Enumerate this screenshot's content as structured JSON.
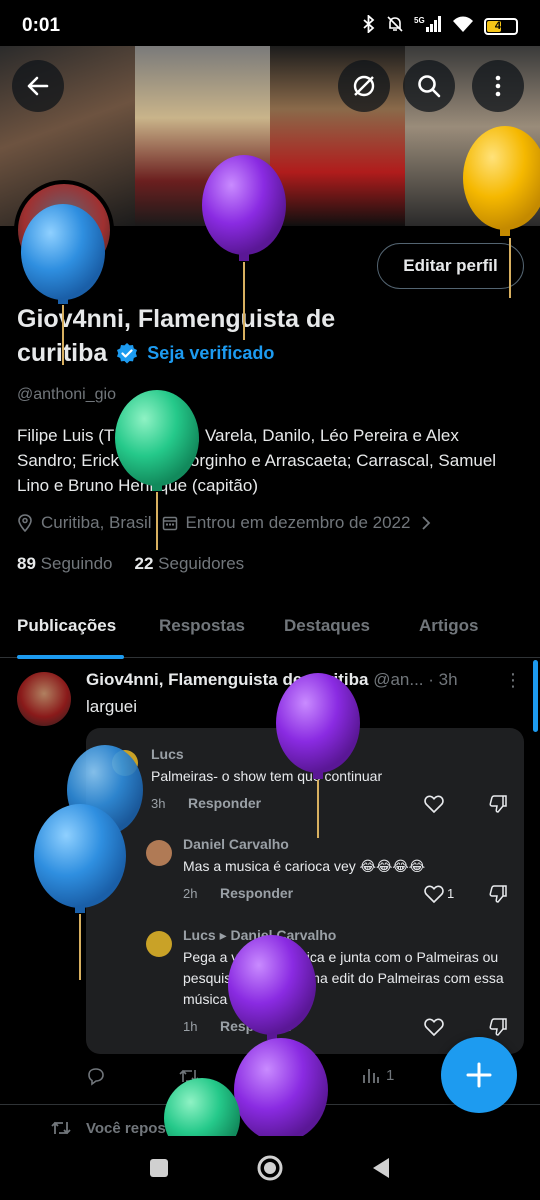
{
  "status_bar": {
    "time": "0:01",
    "network": "5G",
    "battery_level": "45",
    "battery_fraction": 0.45,
    "icons": [
      "bluetooth-icon",
      "mute-icon",
      "signal-icon",
      "wifi-icon",
      "battery-icon"
    ]
  },
  "header": {
    "back_icon": "arrow-left-icon",
    "no_image_icon": "image-off-icon",
    "search_icon": "search-icon",
    "more_icon": "more-vertical-icon"
  },
  "profile": {
    "edit_button": "Editar perfil",
    "name_line1": "Giov4nni, Flamenguista de",
    "name_line2": "curitiba",
    "verify_link": "Seja verificado",
    "handle": "@anthoni_gio",
    "bio": "Filipe Luis (TEC), Rossi, Varela, Danilo, Léo Pereira e Alex Sandro; Erick Pulgar, Jorginho e Arrascaeta; Carrascal, Samuel Lino e Bruno Henrique (capitão)",
    "location": "Curitiba, Brasil",
    "joined": "Entrou em dezembro de 2022",
    "following_count": "89",
    "following_label": "Seguindo",
    "followers_count": "22",
    "followers_label": "Seguidores"
  },
  "tabs": [
    {
      "label": "Publicações",
      "active": true
    },
    {
      "label": "Respostas",
      "active": false
    },
    {
      "label": "Destaques",
      "active": false
    },
    {
      "label": "Artigos",
      "active": false
    }
  ],
  "post": {
    "author": "Giov4nni, Flamenguista de curitiba",
    "handle_time": "@an... · 3h",
    "text": "larguei",
    "comments": [
      {
        "name": "Lucs",
        "text": "Palmeiras- o show tem que continuar",
        "time": "3h",
        "reply": "Responder",
        "likes": ""
      },
      {
        "name": "Daniel Carvalho",
        "text": "Mas a musica é carioca vey 😂😂😂😂",
        "time": "2h",
        "reply": "Responder",
        "likes": "1"
      },
      {
        "name": "Lucs",
        "reply_to": "Daniel Carvalho",
        "text": "Pega a vibe da música e junta com o Palmeiras ou pesquisa aq no ttk uma edit do Palmeiras com essa música , combina d+",
        "time": "1h",
        "reply": "Responder",
        "likes": ""
      }
    ],
    "actions": {
      "views": "1"
    }
  },
  "repost_label": "Você repostou",
  "colors": {
    "accent": "#1d9bf0",
    "background": "#000000",
    "muted": "#71767b",
    "text": "#e7e9ea",
    "card": "#1e1f21"
  },
  "balloons": [
    "blue",
    "purple",
    "yellow",
    "green",
    "purple",
    "blue",
    "blue",
    "purple",
    "purple",
    "green"
  ]
}
